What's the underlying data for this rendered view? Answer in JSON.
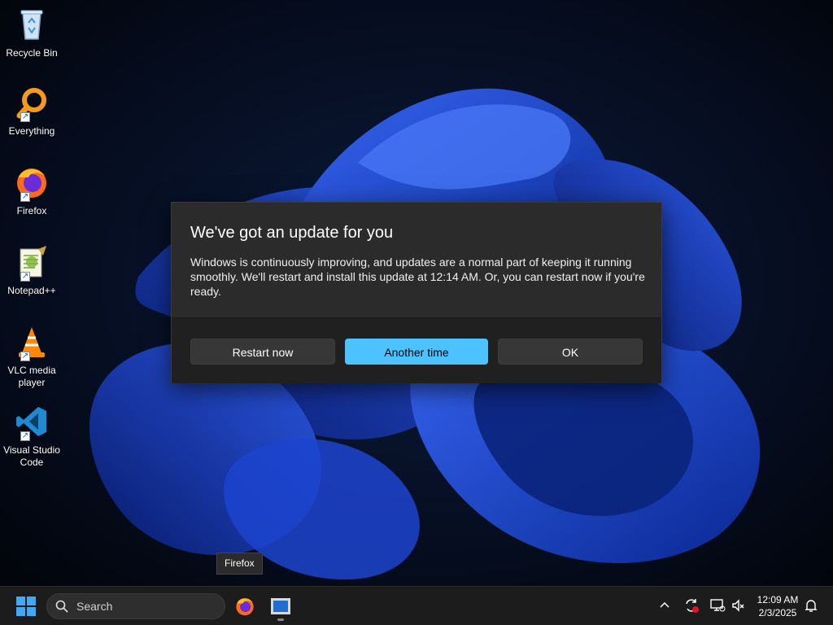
{
  "desktop": {
    "icons": [
      {
        "label": "Recycle Bin",
        "icon": "recycle-bin-icon"
      },
      {
        "label": "Everything",
        "icon": "everything-search-icon"
      },
      {
        "label": "Firefox",
        "icon": "firefox-icon"
      },
      {
        "label": "Notepad++",
        "icon": "notepad-plus-plus-icon"
      },
      {
        "label": "VLC media player",
        "icon": "vlc-icon"
      },
      {
        "label": "Visual Studio Code",
        "icon": "vscode-icon"
      }
    ]
  },
  "dialog": {
    "title": "We've got an update for you",
    "message": "Windows is continuously improving, and updates are a normal part of keeping it running smoothly. We'll restart and install this update at 12:14 AM. Or, you can restart now if you're ready.",
    "buttons": {
      "restart_now": "Restart now",
      "another_time": "Another time",
      "ok": "OK"
    },
    "accent": "#4cc2ff"
  },
  "tooltip": "Firefox",
  "taskbar": {
    "search_placeholder": "Search",
    "time": "12:09 AM",
    "date": "2/3/2025"
  }
}
